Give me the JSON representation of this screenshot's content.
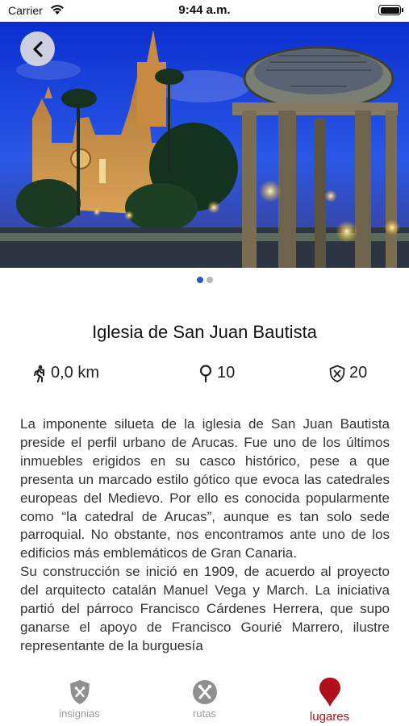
{
  "status_bar": {
    "carrier": "Carrier",
    "time": "9:44 a.m."
  },
  "hero": {
    "image_description_icon": "church-photo",
    "carousel": {
      "count": 2,
      "active_index": 0
    }
  },
  "place": {
    "title": "Iglesia de San Juan Bautista",
    "distance": "0,0 km",
    "points": "10",
    "badges": "20"
  },
  "description": {
    "paragraph_1": "La imponente silueta de la iglesia de San Juan Bautista preside el perfil urbano de Arucas. Fue uno de los últimos inmuebles erigidos en su casco histórico, pese a que presenta un marcado estilo gótico que evoca las catedrales europeas del Medievo. Por ello es conocida popularmente como “la catedral de Arucas”, aunque es tan solo sede parroquial. No obstante, nos encontramos ante uno de los edificios más emblemáticos de Gran Canaria.",
    "paragraph_2": "Su construcción se inició en 1909, de acuerdo al proyecto del arquitecto catalán Manuel Vega y March. La iniciativa partió del párroco Francisco Cárdenes Herrera, que supo ganarse el apoyo de Francisco Gourié Marrero, ilustre representante de la burguesía"
  },
  "tab_bar": {
    "tabs": [
      {
        "label": "insignias",
        "icon": "shield-icon",
        "active": false
      },
      {
        "label": "rutas",
        "icon": "crossed-tools-icon",
        "active": false
      },
      {
        "label": "lugares",
        "icon": "map-pin-icon",
        "active": true
      }
    ]
  },
  "colors": {
    "accent": "#b0101b",
    "carousel_active": "#2b55d6",
    "tab_inactive": "#9a9a9a"
  }
}
